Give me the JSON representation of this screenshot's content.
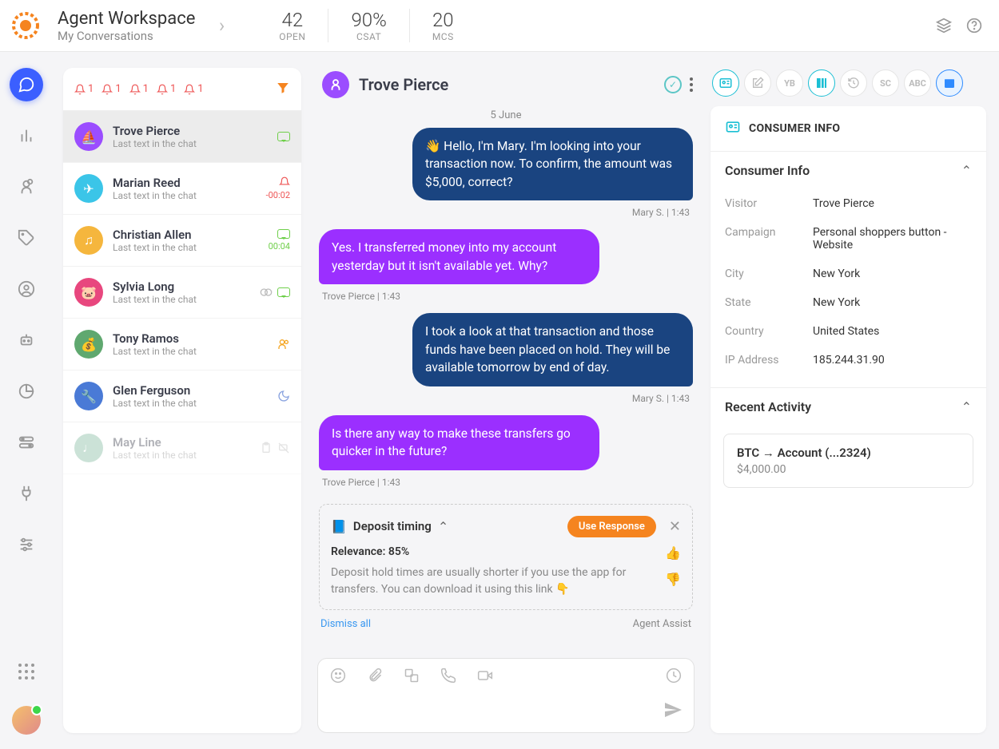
{
  "header": {
    "title": "Agent Workspace",
    "subtitle": "My Conversations",
    "stats": [
      {
        "value": "42",
        "label": "OPEN"
      },
      {
        "value": "90%",
        "label": "CSAT"
      },
      {
        "value": "20",
        "label": "MCS"
      }
    ]
  },
  "bell_counts": [
    "1",
    "1",
    "1",
    "1",
    "1"
  ],
  "conversations": [
    {
      "name": "Trove Pierce",
      "sub": "Last text in the chat",
      "color": "#9b4dff",
      "class": "selected",
      "meta_type": "bubble-green"
    },
    {
      "name": "Marian Reed",
      "sub": "Last text in the chat",
      "color": "#3bc5e8",
      "class": "",
      "meta_type": "bell",
      "time": "-00:02"
    },
    {
      "name": "Christian Allen",
      "sub": "Last text in the chat",
      "color": "#f5b63d",
      "class": "",
      "meta_type": "bubble-green-time",
      "time": "00:04"
    },
    {
      "name": "Sylvia Long",
      "sub": "Last text in the chat",
      "color": "#e8477e",
      "class": "",
      "meta_type": "ring-bubble"
    },
    {
      "name": "Tony Ramos",
      "sub": "Last text in the chat",
      "color": "#5fa86f",
      "class": "",
      "meta_type": "users"
    },
    {
      "name": "Glen Ferguson",
      "sub": "Last text in the chat",
      "color": "#4a7ad6",
      "class": "",
      "meta_type": "moon"
    },
    {
      "name": "May Line",
      "sub": "Last text in the chat",
      "color": "#7fb89e",
      "class": "faded",
      "meta_type": "clip-nochat"
    }
  ],
  "chat": {
    "name": "Trove Pierce",
    "date": "5 June",
    "messages": [
      {
        "who": "agent",
        "text": "👋 Hello, I'm Mary. I'm looking into your transaction now. To confirm, the amount was $5,000, correct?",
        "meta": "Mary  S. |  1:43",
        "align": "right"
      },
      {
        "who": "cust",
        "text": "Yes. I transferred money into my account yesterday but it isn't available yet. Why?",
        "meta": "Trove Pierce  |  1:43",
        "align": "left"
      },
      {
        "who": "agent",
        "text": "I took a look at that transaction and those funds have been placed on hold. They will be available tomorrow by end of day.",
        "meta": "Mary  S. |  1:43",
        "align": "right"
      },
      {
        "who": "cust",
        "text": "Is there any way to make these transfers go quicker in the future?",
        "meta": "Trove Pierce  |  1:43",
        "align": "left"
      }
    ],
    "suggestion": {
      "title": "Deposit timing",
      "use_label": "Use Response",
      "relevance_label": "Relevance:",
      "relevance_value": "85%",
      "body": "Deposit hold times are usually shorter if you use the app for transfers. You can download it using this link 👇",
      "dismiss": "Dismiss all",
      "assist": "Agent Assist"
    }
  },
  "info": {
    "header": "CONSUMER INFO",
    "section1": "Consumer Info",
    "rows": [
      {
        "k": "Visitor",
        "v": "Trove Pierce"
      },
      {
        "k": "Campaign",
        "v": "Personal shoppers button - Website"
      },
      {
        "k": "City",
        "v": "New York"
      },
      {
        "k": "State",
        "v": "New York"
      },
      {
        "k": "Country",
        "v": "United States"
      },
      {
        "k": "IP Address",
        "v": "185.244.31.90"
      }
    ],
    "section2": "Recent Activity",
    "activity": {
      "title": "BTC → Account  (...2324)",
      "amount": "$4,000.00"
    }
  },
  "tools": [
    "id-card",
    "edit",
    "YB",
    "grid",
    "history",
    "SC",
    "ABC",
    "cal"
  ]
}
